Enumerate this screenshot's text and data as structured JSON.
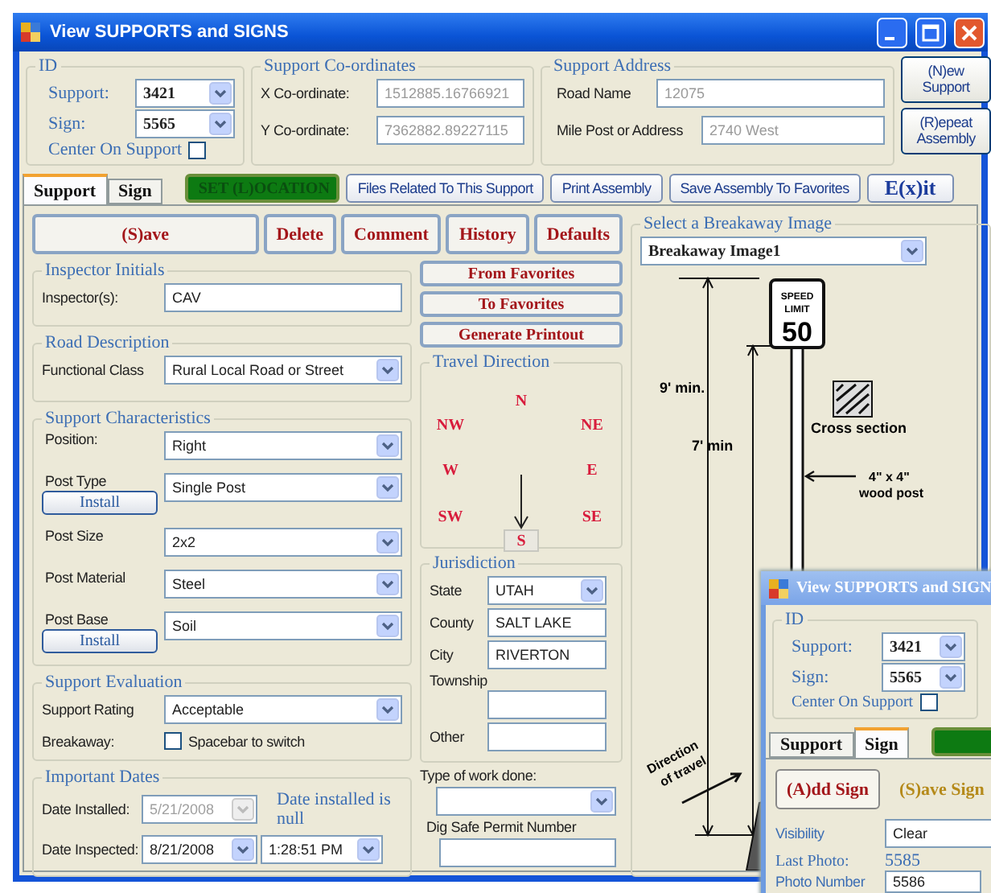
{
  "window": {
    "title": "View SUPPORTS and SIGNS"
  },
  "id_group": {
    "title": "ID",
    "support": {
      "label": "Support:",
      "value": "3421"
    },
    "sign": {
      "label": "Sign:",
      "value": "5565"
    },
    "center": {
      "label": "Center On Support",
      "checked": false
    }
  },
  "coordinates": {
    "title": "Support Co-ordinates",
    "fields": [
      {
        "label": "X Co-ordinate:",
        "value": "1512885.16766921"
      },
      {
        "label": "Y Co-ordinate:",
        "value": "7362882.89227115"
      }
    ]
  },
  "address": {
    "title": "Support Address",
    "fields": [
      {
        "label": "Road Name",
        "value": "12075"
      },
      {
        "label": "Mile Post or Address",
        "value": "2740 West"
      }
    ]
  },
  "side_buttons": [
    "(N)ew Support",
    "(R)epeat Assembly"
  ],
  "tabs": [
    {
      "label": "Support",
      "selected": true
    },
    {
      "label": "Sign",
      "selected": false
    }
  ],
  "toolbar": [
    {
      "label": "SET (L)OCATION",
      "kind": "location"
    },
    {
      "label": "Files Related To This Support",
      "kind": "plain"
    },
    {
      "label": "Print Assembly",
      "kind": "plain"
    },
    {
      "label": "Save Assembly To Favorites",
      "kind": "plain"
    },
    {
      "label": "E(x)it",
      "kind": "exit"
    }
  ],
  "actions": [
    "(S)ave",
    "Delete",
    "Comment",
    "History",
    "Defaults"
  ],
  "favorites": [
    "From Favorites",
    "To Favorites",
    "Generate Printout"
  ],
  "inspector": {
    "title": "Inspector Initials",
    "label": "Inspector(s):",
    "value": "CAV"
  },
  "road": {
    "title": "Road Description",
    "label": "Functional Class",
    "value": "Rural Local Road or Street"
  },
  "characteristics": {
    "title": "Support Characteristics",
    "rows": [
      {
        "label": "Position:",
        "value": "Right"
      },
      {
        "label": "Post Type",
        "value": "Single Post",
        "button": "Install"
      },
      {
        "label": "Post Size",
        "value": "2x2"
      },
      {
        "label": "Post Material",
        "value": "Steel"
      },
      {
        "label": "Post Base",
        "value": "Soil",
        "button": "Install"
      }
    ]
  },
  "evaluation": {
    "title": "Support Evaluation",
    "rating": {
      "label": "Support Rating",
      "value": "Acceptable"
    },
    "breakaway": {
      "label": "Breakaway:",
      "checkbox_label": "Spacebar to switch",
      "checked": false
    }
  },
  "dates": {
    "title": "Important Dates",
    "installed": {
      "label": "Date Installed:",
      "value": "5/21/2008",
      "disabled": true
    },
    "note": "Date installed is null",
    "inspected": {
      "label": "Date Inspected:",
      "value": "8/21/2008",
      "time": "1:28:51 PM"
    }
  },
  "travel_direction": {
    "title": "Travel Direction",
    "directions": [
      {
        "label": "N",
        "selected": false
      },
      {
        "label": "NW",
        "selected": false
      },
      {
        "label": "NE",
        "selected": false
      },
      {
        "label": "W",
        "selected": false
      },
      {
        "label": "E",
        "selected": false
      },
      {
        "label": "SW",
        "selected": false
      },
      {
        "label": "SE",
        "selected": false
      },
      {
        "label": "S",
        "selected": true
      }
    ]
  },
  "jurisdiction": {
    "title": "Jurisdiction",
    "fields": [
      {
        "label": "State",
        "value": "UTAH",
        "kind": "select"
      },
      {
        "label": "County",
        "value": "SALT LAKE",
        "kind": "text"
      },
      {
        "label": "City",
        "value": "RIVERTON",
        "kind": "text"
      },
      {
        "label": "Township",
        "kind": "stacked"
      },
      {
        "label": "Other",
        "kind": "text"
      }
    ]
  },
  "work": {
    "label": "Type of work done:"
  },
  "dig_safe": {
    "label": "Dig Safe Permit Number"
  },
  "breakaway_image": {
    "title": "Select a Breakaway Image",
    "value": "Breakaway Image1",
    "drawing": {
      "sign_top": "SPEED",
      "sign_mid": "LIMIT",
      "sign_number": "50",
      "height_outer": "9' min.",
      "height_inner": "7' min",
      "cross_section": "Cross section",
      "post_size": "4\" x 4\"",
      "post_type": "wood post",
      "direction": [
        "Direction",
        "of travel"
      ]
    }
  },
  "second_window": {
    "title": "View SUPPORTS and SIGN",
    "id_title": "ID",
    "support": {
      "label": "Support:",
      "value": "3421"
    },
    "sign": {
      "label": "Sign:",
      "value": "5565"
    },
    "center": {
      "label": "Center On Support",
      "checked": false
    },
    "tabs": [
      {
        "label": "Support",
        "selected": false
      },
      {
        "label": "Sign",
        "selected": true
      }
    ],
    "buttons": [
      "(A)dd Sign",
      "(S)ave Sign"
    ],
    "visibility": {
      "label": "Visibility",
      "value": "Clear"
    },
    "last_photo": {
      "label": "Last Photo:",
      "value": "5585"
    },
    "photo_number": {
      "label": "Photo Number",
      "value": "5586"
    }
  }
}
